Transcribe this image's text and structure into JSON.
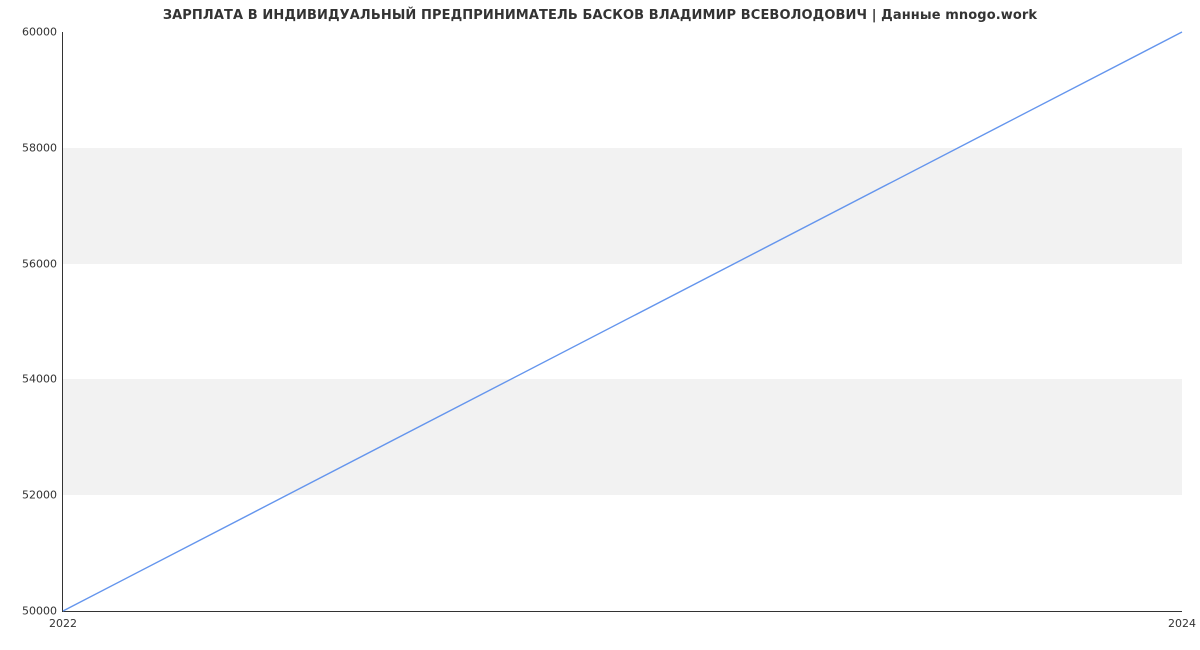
{
  "chart_data": {
    "type": "line",
    "title": "ЗАРПЛАТА В ИНДИВИДУАЛЬНЫЙ ПРЕДПРИНИМАТЕЛЬ БАСКОВ ВЛАДИМИР ВСЕВОЛОДОВИЧ | Данные mnogo.work",
    "xlabel": "",
    "ylabel": "",
    "x_ticks": [
      2022,
      2024
    ],
    "y_ticks": [
      50000,
      52000,
      54000,
      56000,
      58000,
      60000
    ],
    "xlim": [
      2022,
      2024
    ],
    "ylim": [
      50000,
      60000
    ],
    "series": [
      {
        "name": "salary",
        "x": [
          2022,
          2024
        ],
        "values": [
          50000,
          60000
        ]
      }
    ],
    "bands": [
      [
        52000,
        54000
      ],
      [
        56000,
        58000
      ]
    ],
    "colors": {
      "line": "#6495ed",
      "band": "#f2f2f2",
      "axis": "#333333",
      "bg": "#ffffff"
    }
  }
}
